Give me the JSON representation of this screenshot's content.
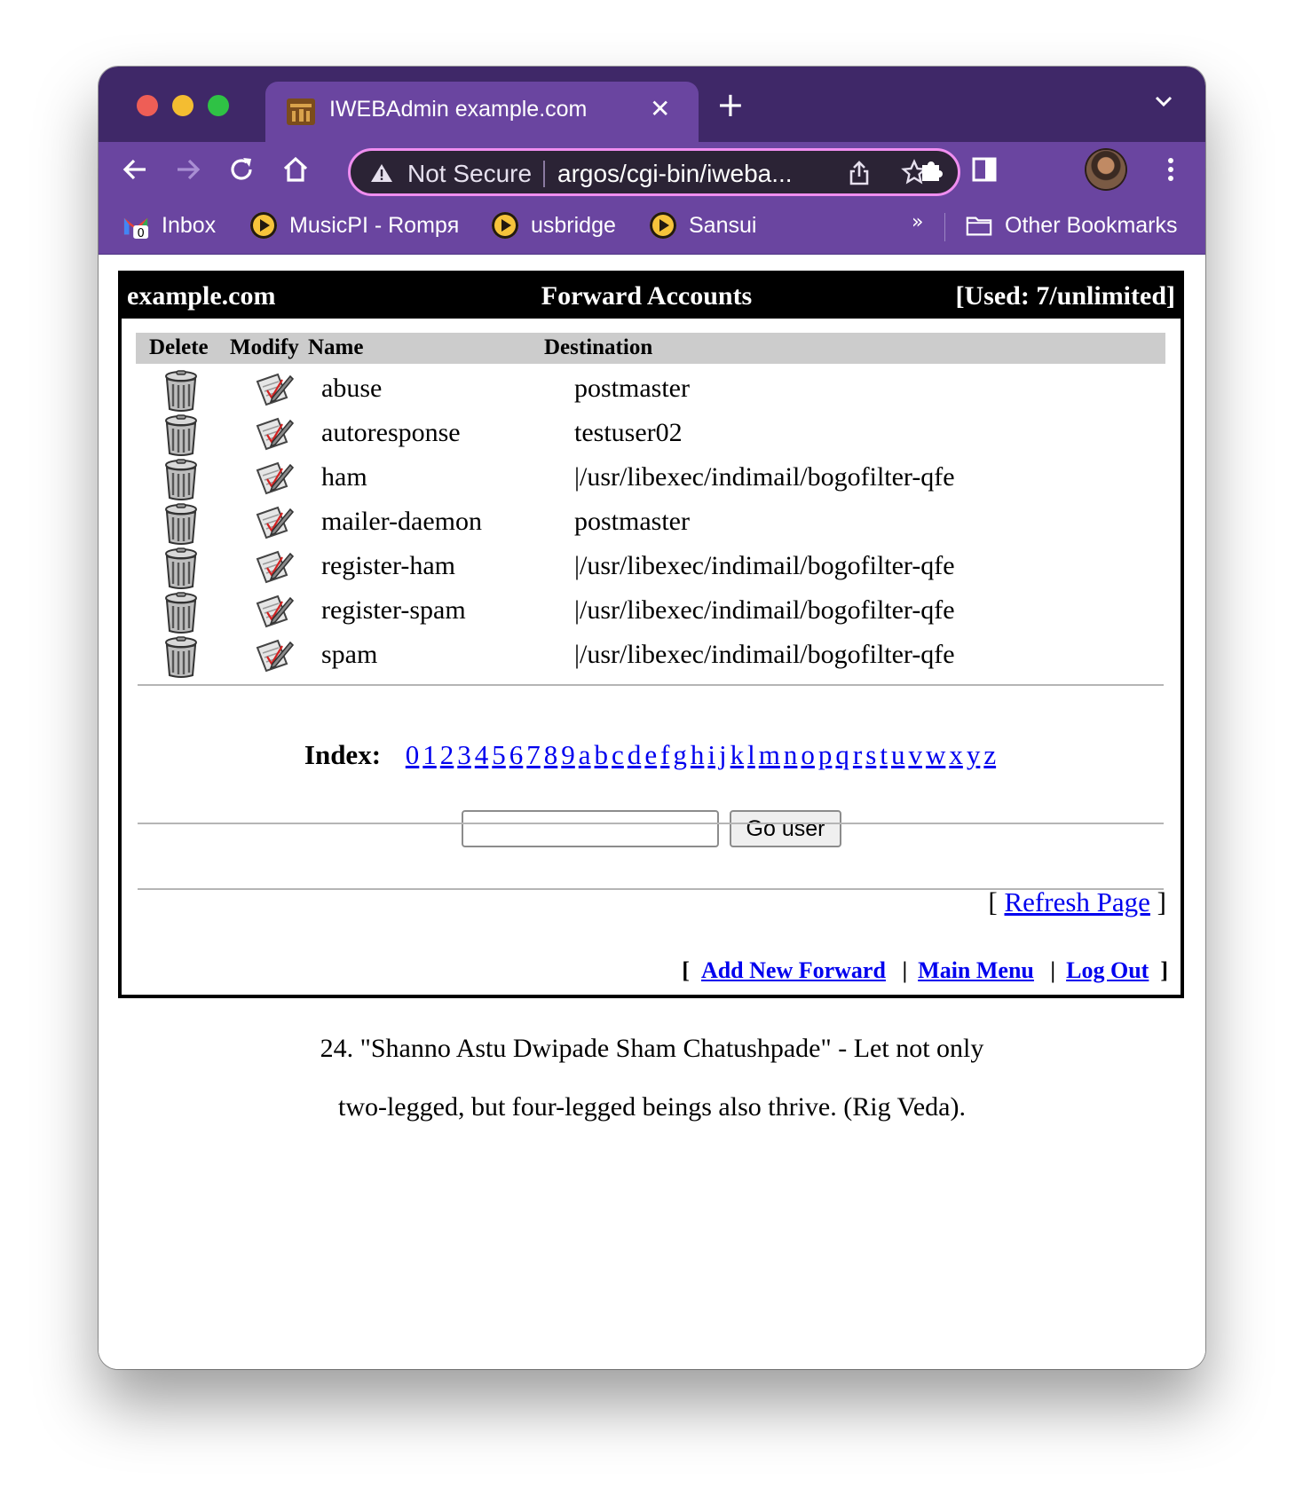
{
  "browser": {
    "tab_title": "IWEBAdmin example.com",
    "security_label": "Not Secure",
    "url": "argos/cgi-bin/iweba...",
    "bookmarks": [
      {
        "label": "Inbox",
        "icon": "gmail-icon"
      },
      {
        "label": "MusicPI - Rompя",
        "icon": "play-icon"
      },
      {
        "label": "usbridge",
        "icon": "play-icon"
      },
      {
        "label": "Sansui",
        "icon": "play-icon"
      }
    ],
    "bookmarks_overflow": "»",
    "other_bookmarks": "Other Bookmarks",
    "gmail_badge": "0"
  },
  "header": {
    "domain": "example.com",
    "title": "Forward Accounts",
    "used": "[Used: 7/unlimited]"
  },
  "table": {
    "columns": [
      "Delete",
      "Modify",
      "Name",
      "Destination"
    ],
    "rows": [
      {
        "name": "abuse",
        "destination": "postmaster"
      },
      {
        "name": "autoresponse",
        "destination": "testuser02"
      },
      {
        "name": "ham",
        "destination": "|/usr/libexec/indimail/bogofilter-qfe"
      },
      {
        "name": "mailer-daemon",
        "destination": "postmaster"
      },
      {
        "name": "register-ham",
        "destination": "|/usr/libexec/indimail/bogofilter-qfe"
      },
      {
        "name": "register-spam",
        "destination": "|/usr/libexec/indimail/bogofilter-qfe"
      },
      {
        "name": "spam",
        "destination": "|/usr/libexec/indimail/bogofilter-qfe"
      }
    ]
  },
  "index": {
    "label": "Index:",
    "letters": [
      "0",
      "1",
      "2",
      "3",
      "4",
      "5",
      "6",
      "7",
      "8",
      "9",
      "a",
      "b",
      "c",
      "d",
      "e",
      "f",
      "g",
      "h",
      "i",
      "j",
      "k",
      "l",
      "m",
      "n",
      "o",
      "p",
      "q",
      "r",
      "s",
      "t",
      "u",
      "v",
      "w",
      "x",
      "y",
      "z"
    ]
  },
  "go_user": {
    "input_value": "",
    "button_label": "Go user"
  },
  "refresh": {
    "open": "[ ",
    "label": "Refresh Page",
    "close": " ]"
  },
  "footer_links": {
    "open": "[",
    "add_new_forward": "Add New Forward",
    "main_menu": "Main Menu",
    "log_out": "Log Out",
    "separator": "|",
    "close": "]"
  },
  "quote": {
    "line1": "24. \"Shanno Astu Dwipade Sham Chatushpade\" - Let not only",
    "line2": "two-legged, but four-legged beings also thrive. (Rig Veda)."
  }
}
